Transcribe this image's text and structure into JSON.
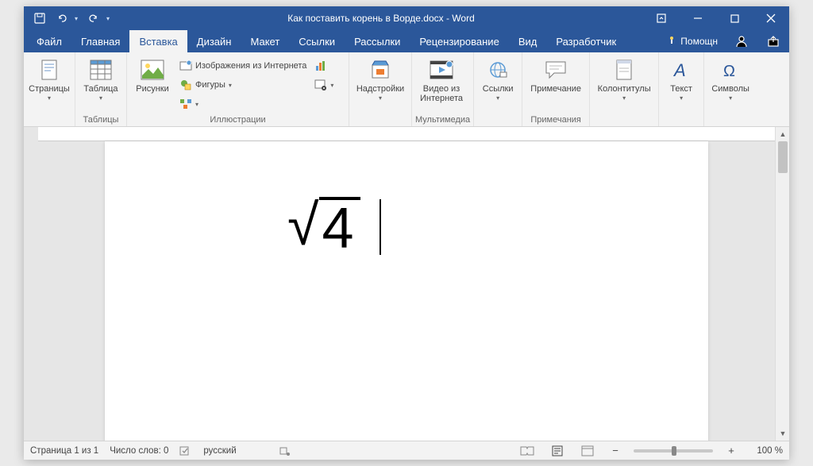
{
  "title": "Как поставить корень в Ворде.docx - Word",
  "tabs": {
    "file": "Файл",
    "home": "Главная",
    "insert": "Вставка",
    "design": "Дизайн",
    "layout": "Макет",
    "references": "Ссылки",
    "mailings": "Рассылки",
    "review": "Рецензирование",
    "view": "Вид",
    "developer": "Разработчик",
    "help": "Помощн"
  },
  "ribbon": {
    "pages": {
      "btn": "Страницы",
      "group": ""
    },
    "tables": {
      "btn": "Таблица",
      "group": "Таблицы"
    },
    "illustrations": {
      "pictures": "Рисунки",
      "online_pics": "Изображения из Интернета",
      "shapes": "Фигуры",
      "group": "Иллюстрации"
    },
    "addins": {
      "btn": "Надстройки",
      "group": ""
    },
    "media": {
      "btn": "Видео из Интернета",
      "group": "Мультимедиа"
    },
    "links": {
      "btn": "Ссылки",
      "group": ""
    },
    "comments": {
      "btn": "Примечание",
      "group": "Примечания"
    },
    "headerfooter": {
      "btn": "Колонтитулы",
      "group": ""
    },
    "text": {
      "btn": "Текст",
      "group": ""
    },
    "symbols": {
      "btn": "Символы",
      "group": ""
    }
  },
  "document": {
    "radicand": "4"
  },
  "statusbar": {
    "page": "Страница 1 из 1",
    "words": "Число слов: 0",
    "lang": "русский",
    "zoom": "100 %"
  }
}
